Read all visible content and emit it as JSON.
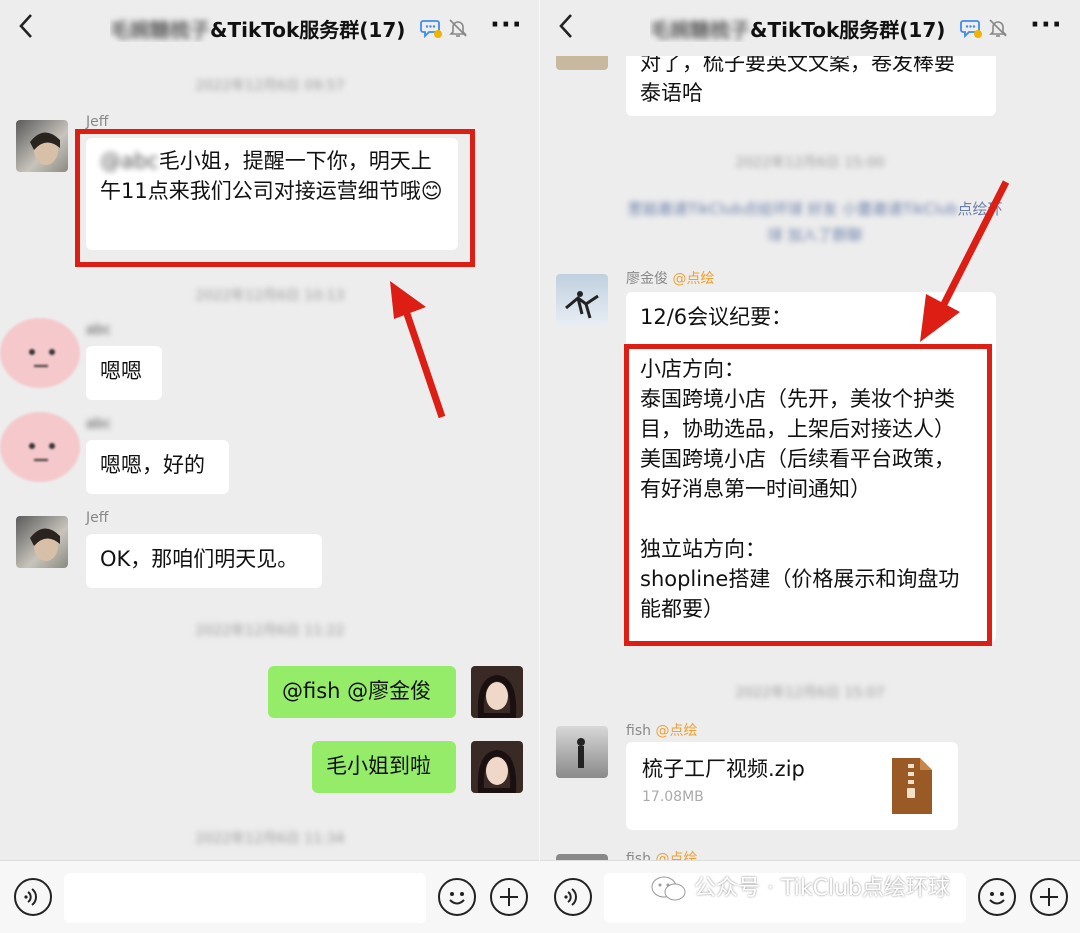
{
  "header": {
    "title_blur": "毛婉糖梳子",
    "title_main": "&TikTok服务群(17)",
    "back_label": "<",
    "more_label": "···"
  },
  "left": {
    "timestamps": [
      "2022年12月6日 09:57",
      "2022年12月6日 10:13",
      "2022年12月6日 11:22",
      "2022年12月6日 11:34"
    ],
    "messages": {
      "jeff1": {
        "sender": "Jeff",
        "mention_blur": "@abc",
        "text": "毛小姐，提醒一下你，明天上午11点来我们公司对接运营细节哦😊"
      },
      "m2": {
        "sender_blur": "abc",
        "text": "嗯嗯"
      },
      "m3": {
        "sender_blur": "abc",
        "text": "嗯嗯，好的"
      },
      "jeff2": {
        "sender": "Jeff",
        "text": "OK，那咱们明天见。"
      },
      "me1": {
        "text": "@fish @廖金俊"
      },
      "me2": {
        "text": "毛小姐到啦"
      }
    }
  },
  "right": {
    "top_msg": {
      "text_line1": "对了，梳子要英文文案，卷发棒要",
      "text_line2": "泰语哈"
    },
    "timestamp1": "2022年12月6日 15:00",
    "system_notice": {
      "blur": "葱姐邀请TikClub点绘环球 好友 小蕾邀请TikClub",
      "tail": "点绘环",
      "blur2": "球 加入了群聊"
    },
    "meeting": {
      "sender": "廖金俊",
      "mention": "@点绘",
      "title": "12/6会议纪要：",
      "lines": [
        "小店方向：",
        "泰国跨境小店（先开，美妆个护类",
        "目，协助选品，上架后对接达人）",
        "美国跨境小店（后续看平台政策，",
        "有好消息第一时间通知）",
        "",
        "独立站方向：",
        "shopline搭建（价格展示和询盘功",
        "能都要）"
      ]
    },
    "timestamp2": "2022年12月6日 15:07",
    "file": {
      "sender": "fish",
      "mention": "@点绘",
      "name": "梳子工厂视频.zip",
      "size": "17.08MB"
    },
    "bottom_sender": {
      "sender": "fish",
      "mention": "@点绘"
    }
  },
  "watermark": "公众号 · TikClub点绘环球",
  "colors": {
    "highlight_red": "#dc1e14",
    "bubble_green": "#95ec69",
    "mention_orange": "#f0a030",
    "background": "#ededed"
  }
}
